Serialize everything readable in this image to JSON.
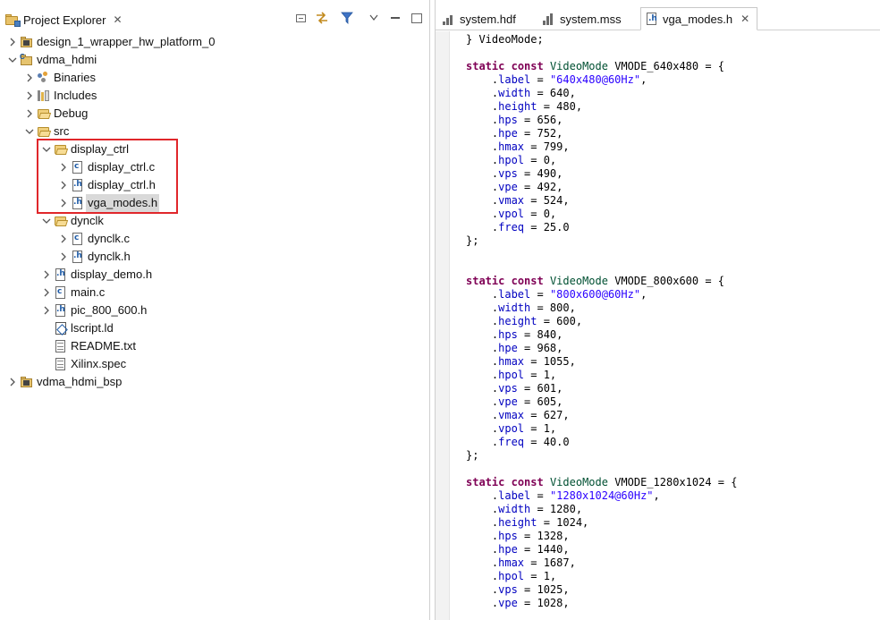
{
  "project_explorer": {
    "title": "Project Explorer",
    "close_glyph": "✕",
    "tree": [
      {
        "label": "design_1_wrapper_hw_platform_0",
        "icon": "hw-platform-icon",
        "depth": 0,
        "expanded": false
      },
      {
        "label": "vdma_hdmi",
        "icon": "c-project-icon",
        "depth": 0,
        "expanded": true
      },
      {
        "label": "Binaries",
        "icon": "binaries-icon",
        "depth": 1,
        "expanded": false
      },
      {
        "label": "Includes",
        "icon": "includes-icon",
        "depth": 1,
        "expanded": false
      },
      {
        "label": "Debug",
        "icon": "folder-icon",
        "depth": 1,
        "expanded": false
      },
      {
        "label": "src",
        "icon": "source-folder-icon",
        "depth": 1,
        "expanded": true
      },
      {
        "label": "display_ctrl",
        "icon": "folder-open-icon",
        "depth": 2,
        "expanded": true
      },
      {
        "label": "display_ctrl.c",
        "icon": "c-file-icon",
        "depth": 3,
        "expanded": false
      },
      {
        "label": "display_ctrl.h",
        "icon": "h-file-icon",
        "depth": 3,
        "expanded": false
      },
      {
        "label": "vga_modes.h",
        "icon": "h-file-icon",
        "depth": 3,
        "expanded": false,
        "selected": true
      },
      {
        "label": "dynclk",
        "icon": "folder-open-icon",
        "depth": 2,
        "expanded": true
      },
      {
        "label": "dynclk.c",
        "icon": "c-file-icon",
        "depth": 3,
        "expanded": false
      },
      {
        "label": "dynclk.h",
        "icon": "h-file-icon",
        "depth": 3,
        "expanded": false
      },
      {
        "label": "display_demo.h",
        "icon": "h-file-icon",
        "depth": 2,
        "expanded": false
      },
      {
        "label": "main.c",
        "icon": "c-file-icon",
        "depth": 2,
        "expanded": false
      },
      {
        "label": "pic_800_600.h",
        "icon": "h-file-icon",
        "depth": 2,
        "expanded": false
      },
      {
        "label": "lscript.ld",
        "icon": "linker-script-icon",
        "depth": 2,
        "leaf": true
      },
      {
        "label": "README.txt",
        "icon": "text-file-icon",
        "depth": 2,
        "leaf": true
      },
      {
        "label": "Xilinx.spec",
        "icon": "spec-file-icon",
        "depth": 2,
        "leaf": true
      },
      {
        "label": "vdma_hdmi_bsp",
        "icon": "bsp-project-icon",
        "depth": 0,
        "expanded": false
      }
    ]
  },
  "editor": {
    "tabs": [
      {
        "label": "system.hdf",
        "icon": "hdf-file-icon",
        "active": false
      },
      {
        "label": "system.mss",
        "icon": "mss-file-icon",
        "active": false
      },
      {
        "label": "vga_modes.h",
        "icon": "h-file-icon",
        "active": true,
        "close_glyph": "✕"
      }
    ],
    "code_lines": [
      [
        [
          "p",
          "} VideoMode;"
        ]
      ],
      [],
      [
        [
          "kw",
          "static"
        ],
        [
          "p",
          " "
        ],
        [
          "kw",
          "const"
        ],
        [
          "p",
          " "
        ],
        [
          "ty",
          "VideoMode"
        ],
        [
          "p",
          " VMODE_640x480 = {"
        ]
      ],
      [
        [
          "p",
          "    ."
        ],
        [
          "fd",
          "label"
        ],
        [
          "p",
          " = "
        ],
        [
          "st",
          "\"640x480@60Hz\""
        ],
        [
          "p",
          ","
        ]
      ],
      [
        [
          "p",
          "    ."
        ],
        [
          "fd",
          "width"
        ],
        [
          "p",
          " = 640,"
        ]
      ],
      [
        [
          "p",
          "    ."
        ],
        [
          "fd",
          "height"
        ],
        [
          "p",
          " = 480,"
        ]
      ],
      [
        [
          "p",
          "    ."
        ],
        [
          "fd",
          "hps"
        ],
        [
          "p",
          " = 656,"
        ]
      ],
      [
        [
          "p",
          "    ."
        ],
        [
          "fd",
          "hpe"
        ],
        [
          "p",
          " = 752,"
        ]
      ],
      [
        [
          "p",
          "    ."
        ],
        [
          "fd",
          "hmax"
        ],
        [
          "p",
          " = 799,"
        ]
      ],
      [
        [
          "p",
          "    ."
        ],
        [
          "fd",
          "hpol"
        ],
        [
          "p",
          " = 0,"
        ]
      ],
      [
        [
          "p",
          "    ."
        ],
        [
          "fd",
          "vps"
        ],
        [
          "p",
          " = 490,"
        ]
      ],
      [
        [
          "p",
          "    ."
        ],
        [
          "fd",
          "vpe"
        ],
        [
          "p",
          " = 492,"
        ]
      ],
      [
        [
          "p",
          "    ."
        ],
        [
          "fd",
          "vmax"
        ],
        [
          "p",
          " = 524,"
        ]
      ],
      [
        [
          "p",
          "    ."
        ],
        [
          "fd",
          "vpol"
        ],
        [
          "p",
          " = 0,"
        ]
      ],
      [
        [
          "p",
          "    ."
        ],
        [
          "fd",
          "freq"
        ],
        [
          "p",
          " = 25.0"
        ]
      ],
      [
        [
          "p",
          "};"
        ]
      ],
      [],
      [],
      [
        [
          "kw",
          "static"
        ],
        [
          "p",
          " "
        ],
        [
          "kw",
          "const"
        ],
        [
          "p",
          " "
        ],
        [
          "ty",
          "VideoMode"
        ],
        [
          "p",
          " VMODE_800x600 = {"
        ]
      ],
      [
        [
          "p",
          "    ."
        ],
        [
          "fd",
          "label"
        ],
        [
          "p",
          " = "
        ],
        [
          "st",
          "\"800x600@60Hz\""
        ],
        [
          "p",
          ","
        ]
      ],
      [
        [
          "p",
          "    ."
        ],
        [
          "fd",
          "width"
        ],
        [
          "p",
          " = 800,"
        ]
      ],
      [
        [
          "p",
          "    ."
        ],
        [
          "fd",
          "height"
        ],
        [
          "p",
          " = 600,"
        ]
      ],
      [
        [
          "p",
          "    ."
        ],
        [
          "fd",
          "hps"
        ],
        [
          "p",
          " = 840,"
        ]
      ],
      [
        [
          "p",
          "    ."
        ],
        [
          "fd",
          "hpe"
        ],
        [
          "p",
          " = 968,"
        ]
      ],
      [
        [
          "p",
          "    ."
        ],
        [
          "fd",
          "hmax"
        ],
        [
          "p",
          " = 1055,"
        ]
      ],
      [
        [
          "p",
          "    ."
        ],
        [
          "fd",
          "hpol"
        ],
        [
          "p",
          " = 1,"
        ]
      ],
      [
        [
          "p",
          "    ."
        ],
        [
          "fd",
          "vps"
        ],
        [
          "p",
          " = 601,"
        ]
      ],
      [
        [
          "p",
          "    ."
        ],
        [
          "fd",
          "vpe"
        ],
        [
          "p",
          " = 605,"
        ]
      ],
      [
        [
          "p",
          "    ."
        ],
        [
          "fd",
          "vmax"
        ],
        [
          "p",
          " = 627,"
        ]
      ],
      [
        [
          "p",
          "    ."
        ],
        [
          "fd",
          "vpol"
        ],
        [
          "p",
          " = 1,"
        ]
      ],
      [
        [
          "p",
          "    ."
        ],
        [
          "fd",
          "freq"
        ],
        [
          "p",
          " = 40.0"
        ]
      ],
      [
        [
          "p",
          "};"
        ]
      ],
      [],
      [
        [
          "kw",
          "static"
        ],
        [
          "p",
          " "
        ],
        [
          "kw",
          "const"
        ],
        [
          "p",
          " "
        ],
        [
          "ty",
          "VideoMode"
        ],
        [
          "p",
          " VMODE_1280x1024 = {"
        ]
      ],
      [
        [
          "p",
          "    ."
        ],
        [
          "fd",
          "label"
        ],
        [
          "p",
          " = "
        ],
        [
          "st",
          "\"1280x1024@60Hz\""
        ],
        [
          "p",
          ","
        ]
      ],
      [
        [
          "p",
          "    ."
        ],
        [
          "fd",
          "width"
        ],
        [
          "p",
          " = 1280,"
        ]
      ],
      [
        [
          "p",
          "    ."
        ],
        [
          "fd",
          "height"
        ],
        [
          "p",
          " = 1024,"
        ]
      ],
      [
        [
          "p",
          "    ."
        ],
        [
          "fd",
          "hps"
        ],
        [
          "p",
          " = 1328,"
        ]
      ],
      [
        [
          "p",
          "    ."
        ],
        [
          "fd",
          "hpe"
        ],
        [
          "p",
          " = 1440,"
        ]
      ],
      [
        [
          "p",
          "    ."
        ],
        [
          "fd",
          "hmax"
        ],
        [
          "p",
          " = 1687,"
        ]
      ],
      [
        [
          "p",
          "    ."
        ],
        [
          "fd",
          "hpol"
        ],
        [
          "p",
          " = 1,"
        ]
      ],
      [
        [
          "p",
          "    ."
        ],
        [
          "fd",
          "vps"
        ],
        [
          "p",
          " = 1025,"
        ]
      ],
      [
        [
          "p",
          "    ."
        ],
        [
          "fd",
          "vpe"
        ],
        [
          "p",
          " = 1028,"
        ]
      ]
    ]
  },
  "colors": {
    "highlight_box": "#e0272b",
    "keyword": "#7f0055",
    "type": "#005032",
    "field": "#0000c0",
    "string": "#2a00ff",
    "selection": "#d9d9d9"
  }
}
